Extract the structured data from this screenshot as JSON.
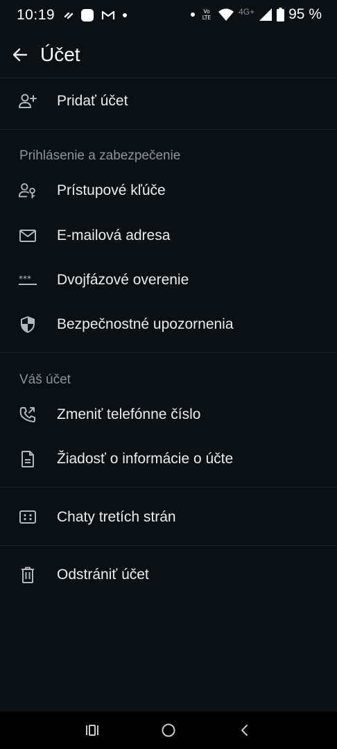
{
  "status_bar": {
    "time": "10:19",
    "battery": "95 %",
    "network": "4G+",
    "volte": "Vo LTE"
  },
  "header": {
    "title": "Účet"
  },
  "items": {
    "add_account": "Pridať účet",
    "passkeys": "Prístupové kľúče",
    "email": "E-mailová adresa",
    "two_step": "Dvojfázové overenie",
    "security_notifications": "Bezpečnostné upozornenia",
    "change_number": "Zmeniť telefónne číslo",
    "request_info": "Žiadosť o informácie o účte",
    "third_party_chats": "Chaty tretích strán",
    "delete_account": "Odstrániť účet"
  },
  "sections": {
    "login_security": "Prihlásenie a zabezpečenie",
    "your_account": "Váš účet"
  },
  "colors": {
    "background": "#0b1014",
    "text_primary": "#e9edef",
    "text_secondary": "#8696a0",
    "icon": "#aebac1"
  }
}
